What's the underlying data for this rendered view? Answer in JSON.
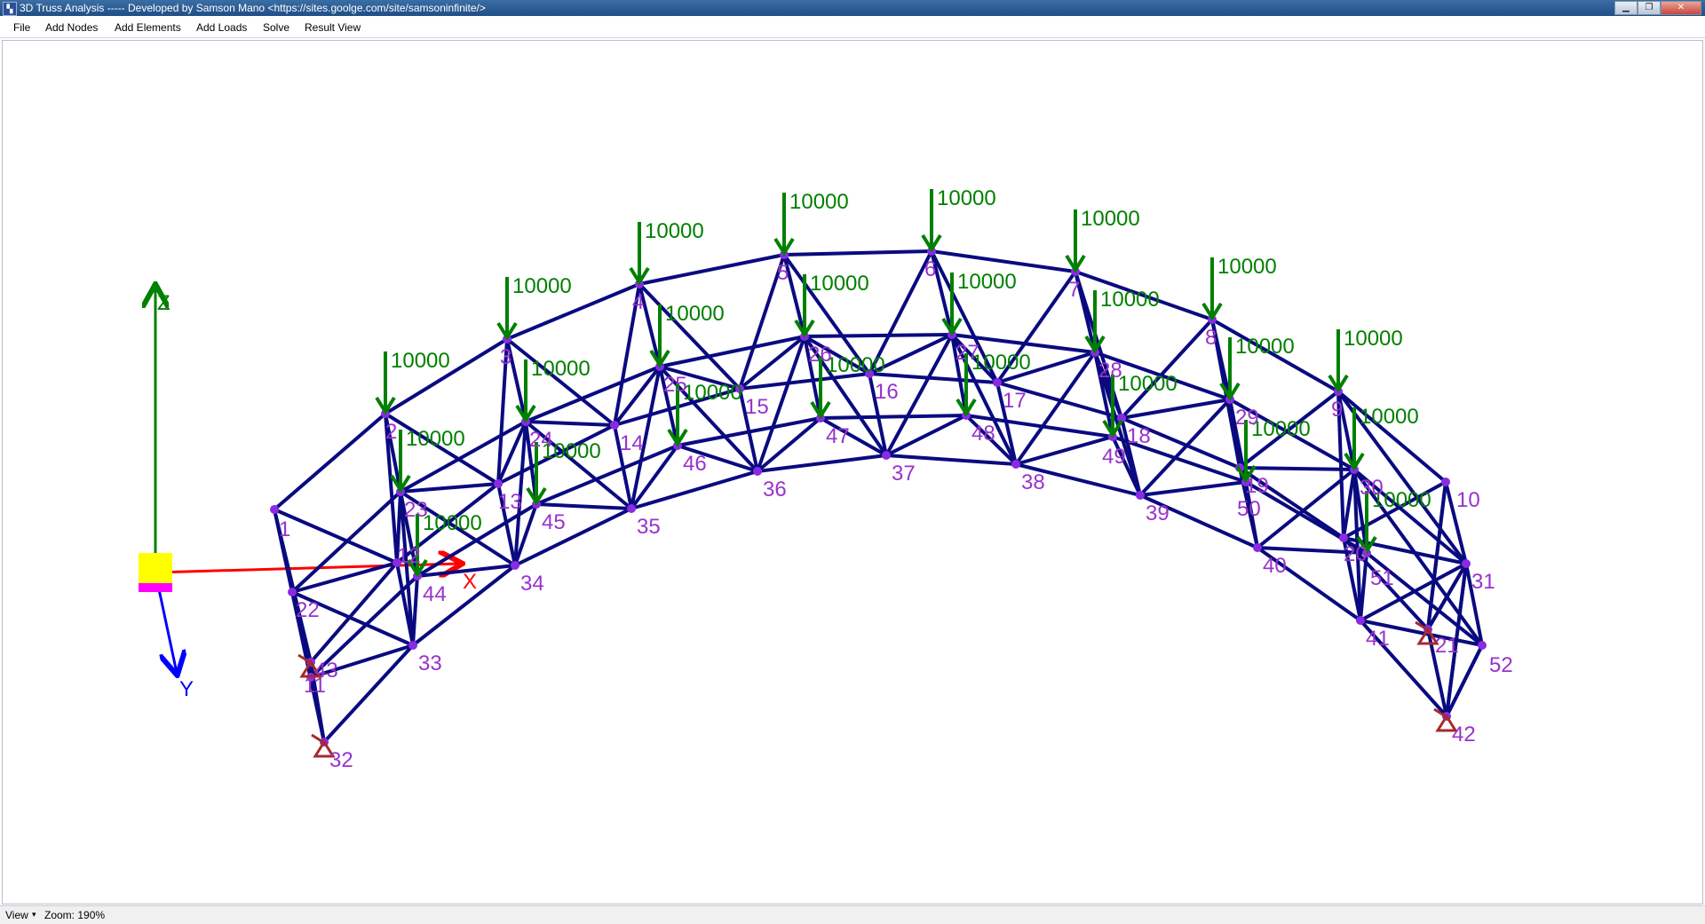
{
  "window": {
    "title": "3D Truss Analysis ----- Developed by Samson Mano <https://sites.goolge.com/site/samsoninfinite/>",
    "app_icon": "truss-app-icon",
    "controls": [
      "minimize-icon",
      "maximize-icon",
      "close-icon"
    ]
  },
  "menu": {
    "file": "File",
    "add_nodes": "Add Nodes",
    "add_elements": "Add Elements",
    "add_loads": "Add Loads",
    "solve": "Solve",
    "result_view": "Result View"
  },
  "axes": {
    "x": "X",
    "y": "Y",
    "z": "Z"
  },
  "colors": {
    "member": "#0a0a80",
    "node": "#8a2be2",
    "node_label": "#9932cc",
    "load": "#008000",
    "support": "#a52a2a",
    "axis_x": "#ff0000",
    "axis_y": "#0000ff",
    "axis_z": "#008000",
    "origin_box": "#ffff00"
  },
  "load_value": "10000",
  "node_labels": {
    "1": "1",
    "2": "2",
    "3": "3",
    "4": "4",
    "5": "5",
    "6": "6",
    "7": "7",
    "8": "8",
    "9": "9",
    "10": "10",
    "11": "11",
    "12": "12",
    "13": "13",
    "14": "14",
    "15": "15",
    "16": "16",
    "17": "17",
    "18": "18",
    "19": "19",
    "20": "20",
    "21": "21",
    "22": "22",
    "23": "23",
    "24": "24",
    "25": "25",
    "26": "26",
    "27": "27",
    "28": "28",
    "29": "29",
    "30": "30",
    "31": "31",
    "32": "32",
    "33": "33",
    "34": "34",
    "35": "35",
    "36": "36",
    "37": "37",
    "38": "38",
    "39": "39",
    "40": "40",
    "41": "41",
    "42": "42",
    "43": "43",
    "44": "44",
    "45": "45",
    "46": "46",
    "47": "47",
    "48": "48",
    "49": "49",
    "50": "50",
    "51": "51",
    "52": "52"
  },
  "status": {
    "view": "View",
    "view_caret": "▾",
    "zoom": "Zoom: 190%"
  }
}
